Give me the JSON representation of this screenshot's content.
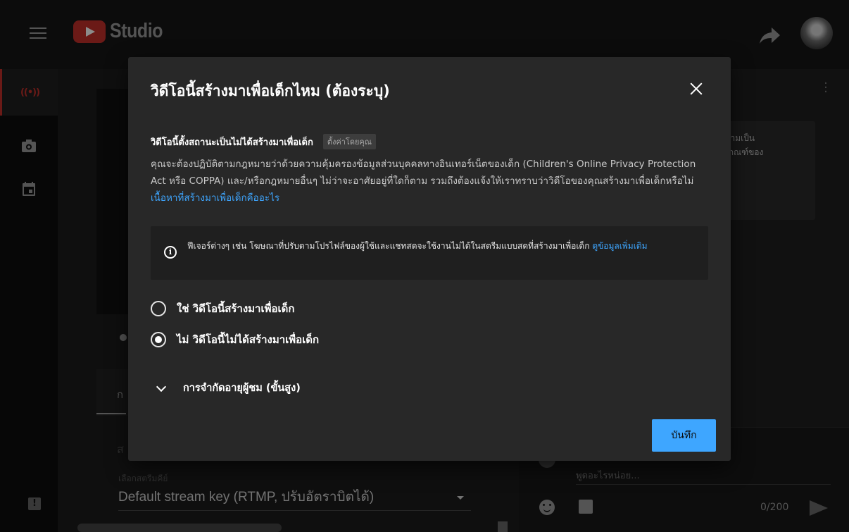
{
  "app": {
    "logo_text": "Studio",
    "brand_color": "#c4302b",
    "accent_color": "#3ea6ff"
  },
  "topbar": {
    "menu_icon": "hamburger-icon",
    "share_icon": "share-arrow-icon",
    "avatar": "user-avatar"
  },
  "leftnav": {
    "items": [
      {
        "icon": "live-broadcast-icon",
        "glyph": "((•))",
        "active": true
      },
      {
        "icon": "camera-icon"
      },
      {
        "icon": "calendar-icon"
      }
    ],
    "feedback_glyph": "!"
  },
  "background": {
    "info_card_lines": [
      "าความเป็น",
      "ลักเกณฑ์ของ"
    ],
    "tab_fragment": "ก",
    "settings_fragment": "ส",
    "stream_key_label": "เลือกสตรีมคีย์",
    "stream_key_value": "Default stream key (RTMP, ปรับอัตราบิตได้)",
    "chat_placeholder": "พูดอะไรหน่อย...",
    "chat_count": "0/200"
  },
  "dialog": {
    "title": "วิดีโอนี้สร้างมาเพื่อเด็กไหม (ต้องระบุ)",
    "status_text": "วิดีโอนี้ตั้งสถานะเป็นไม่ได้สร้างมาเพื่อเด็ก",
    "set_by_badge": "ตั้งค่าโดยคุณ",
    "description": "คุณจะต้องปฏิบัติตามกฎหมายว่าด้วยความคุ้มครองข้อมูลส่วนบุคคลทางอินเทอร์เน็ตของเด็ก (Children's Online Privacy Protection Act หรือ COPPA) และ/หรือกฎหมายอื่นๆ ไม่ว่าจะอาศัยอยู่ที่ใดก็ตาม รวมถึงต้องแจ้งให้เราทราบว่าวิดีโอของคุณสร้างมาเพื่อเด็กหรือไม่",
    "description_link": "เนื้อหาที่สร้างมาเพื่อเด็กคืออะไร",
    "info_text": "ฟีเจอร์ต่างๆ เช่น โฆษณาที่ปรับตามโปรไฟล์ของผู้ใช้และแชทสดจะใช้งานไม่ได้ในสตรีมแบบสดที่สร้างมาเพื่อเด็ก",
    "info_link": "ดูข้อมูลเพิ่มเติม",
    "options": [
      {
        "label": "ใช่ วิดีโอนี้สร้างมาเพื่อเด็ก",
        "checked": false
      },
      {
        "label": "ไม่ วิดีโอนี้ไม่ได้สร้างมาเพื่อเด็ก",
        "checked": true
      }
    ],
    "advanced_label": "การจำกัดอายุผู้ชม (ขั้นสูง)",
    "save_label": "บันทึก"
  }
}
